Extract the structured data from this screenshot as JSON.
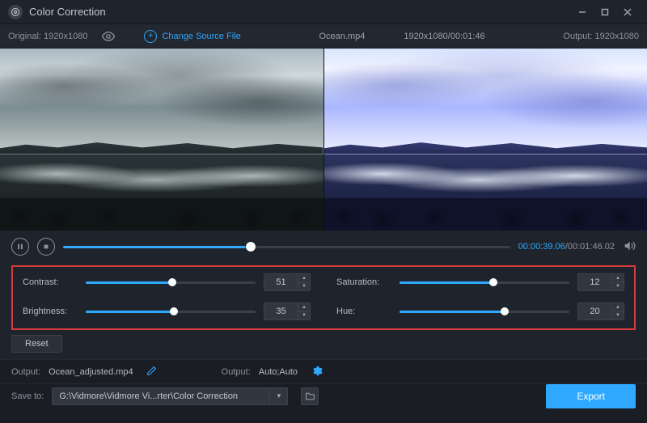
{
  "window": {
    "title": "Color Correction"
  },
  "infobar": {
    "original_label": "Original:",
    "original_res": "1920x1080",
    "change_source_label": "Change Source File",
    "filename": "Ocean.mp4",
    "source_meta": "1920x1080/00:01:46",
    "output_label": "Output:",
    "output_res": "1920x1080"
  },
  "playback": {
    "position_pct": 42,
    "current": "00:00:39.06",
    "total": "00:01:46.02"
  },
  "adjust": {
    "contrast": {
      "label": "Contrast:",
      "value": 51,
      "pct": 51
    },
    "brightness": {
      "label": "Brightness:",
      "value": 35,
      "pct": 52
    },
    "saturation": {
      "label": "Saturation:",
      "value": 12,
      "pct": 55
    },
    "hue": {
      "label": "Hue:",
      "value": 20,
      "pct": 62
    },
    "reset_label": "Reset"
  },
  "output_row": {
    "label": "Output:",
    "filename": "Ocean_adjusted.mp4",
    "format_label": "Output:",
    "format_value": "Auto;Auto"
  },
  "save_row": {
    "label": "Save to:",
    "path": "G:\\Vidmore\\Vidmore Vi...rter\\Color Correction"
  },
  "export_label": "Export"
}
